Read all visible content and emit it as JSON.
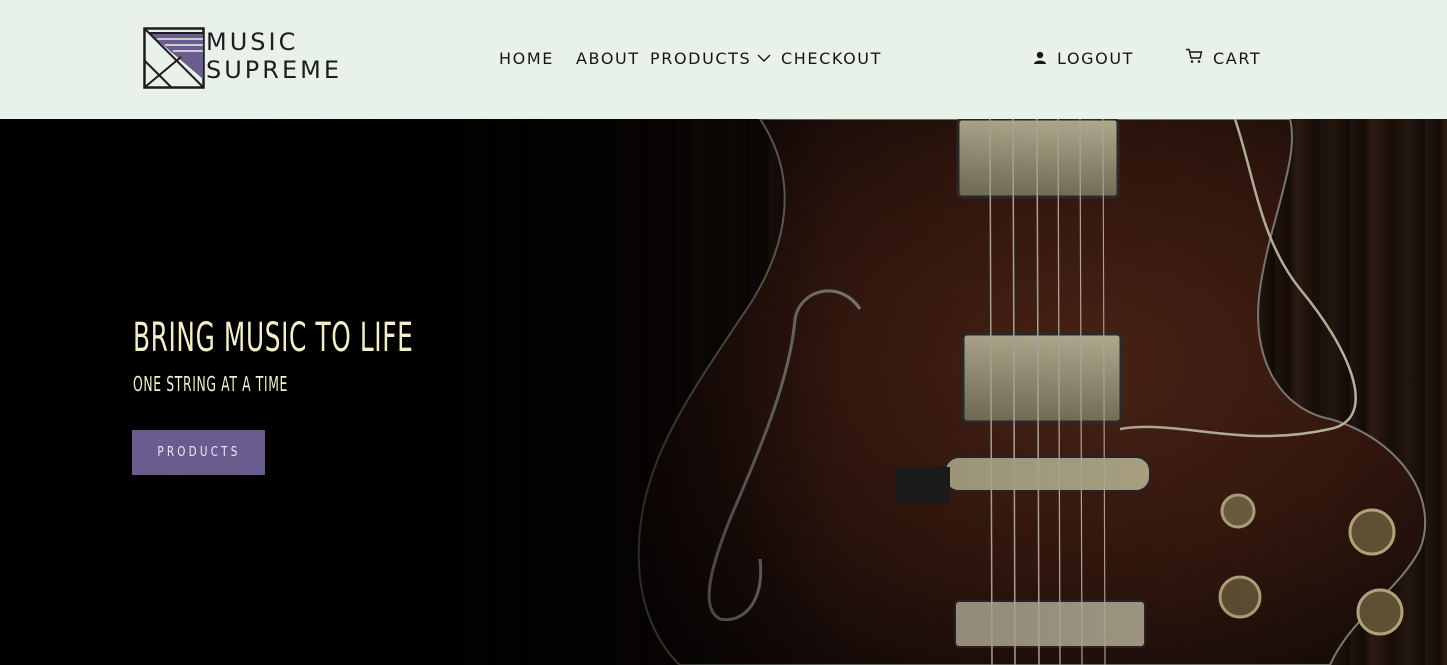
{
  "brand": {
    "line1": "MUSIC",
    "line2": "SUPREME",
    "logo_icon": "triangle-square-logo-icon",
    "accent_color": "#6a5c8c"
  },
  "nav": {
    "home": "HOME",
    "about": "ABOUT",
    "products": "PRODUCTS",
    "products_icon": "chevron-down-icon",
    "checkout": "CHECKOUT",
    "logout": "LOGOUT",
    "logout_icon": "user-icon",
    "cart": "CART",
    "cart_icon": "cart-icon"
  },
  "hero": {
    "title": "BRING MUSIC TO LIFE",
    "subtitle": "ONE STRING AT A TIME",
    "button_label": "PRODUCTS",
    "background": "electric guitar photo",
    "text_color": "#f3f0c6"
  },
  "colors": {
    "header_bg": "#e8f2ea",
    "nav_text": "#161616",
    "button_bg": "#6a5c8c"
  }
}
